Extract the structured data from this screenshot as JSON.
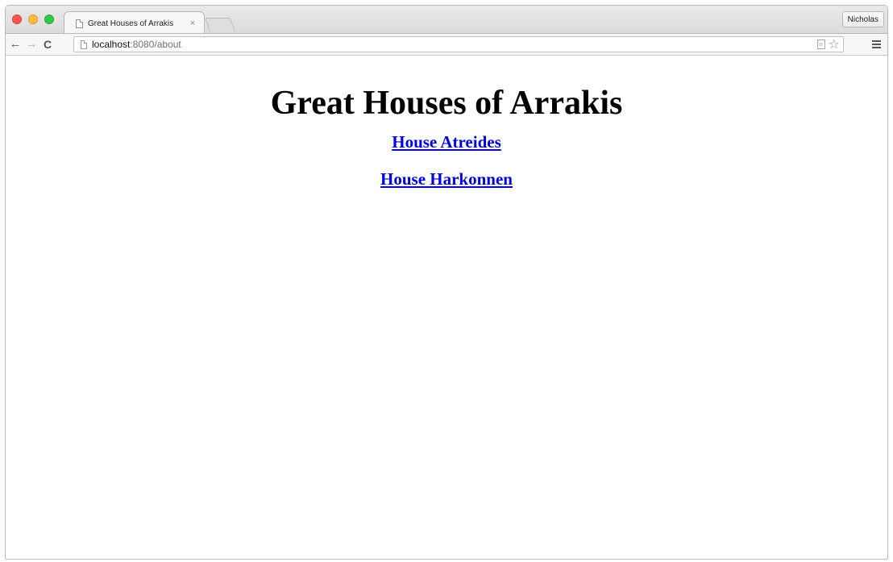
{
  "browser": {
    "tab": {
      "title": "Great Houses of Arrakis",
      "close_glyph": "×"
    },
    "profile": {
      "name": "Nicholas"
    },
    "toolbar": {
      "back_glyph": "←",
      "forward_glyph": "→",
      "reload_glyph": "C",
      "url_host": "localhost",
      "url_path": ":8080/about",
      "star_glyph": "☆"
    },
    "icons": [
      "page-icon",
      "close-icon",
      "back-arrow-icon",
      "forward-arrow-icon",
      "reload-icon",
      "reader-mode-icon",
      "star-icon",
      "menu-icon"
    ],
    "colors": {
      "link": "#0000ee",
      "traffic_red": "#fc5753",
      "traffic_yellow": "#fdbc40",
      "traffic_green": "#33c748"
    }
  },
  "page": {
    "title": "Great Houses of Arrakis",
    "links": [
      {
        "label": "House Atreides"
      },
      {
        "label": "House Harkonnen"
      }
    ]
  }
}
